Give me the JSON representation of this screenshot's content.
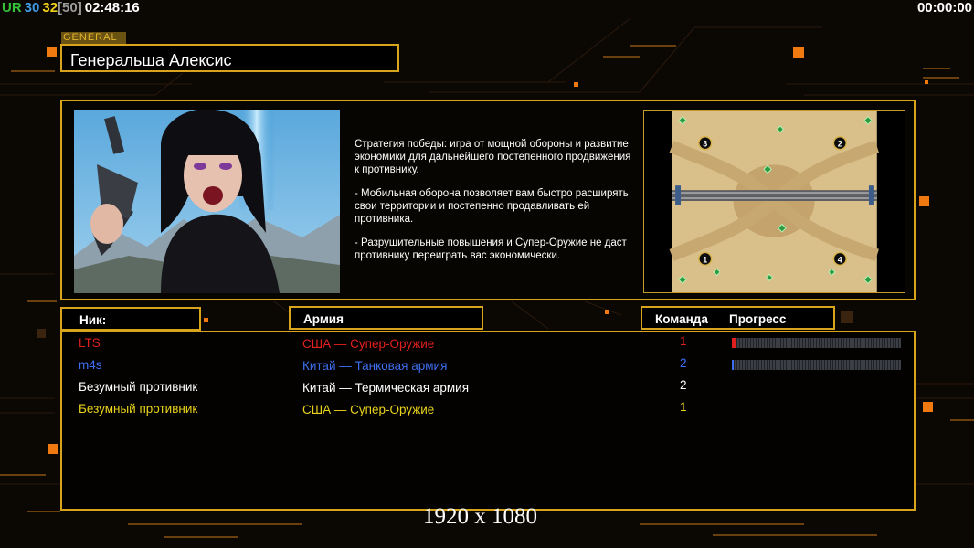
{
  "hud": {
    "tag": "UR",
    "fps": "30",
    "count": "32",
    "count_max": "[50]",
    "clock": "02:48:16",
    "timer": "00:00:00"
  },
  "general": {
    "tag": "GENERAL",
    "name": "Генеральша Алексис"
  },
  "description": {
    "p1": "Стратегия победы: игра от мощной обороны и развитие экономики для дальнейшего постепенного продвижения к противнику.",
    "p2": "- Мобильная оборона позволяет вам быстро расширять свои территории и постепенно продавливать ей противника.",
    "p3": "- Разрушительные повышения и Супер-Оружие не даст противнику переиграть вас экономически."
  },
  "map": {
    "spots": [
      "3",
      "2",
      "1",
      "4"
    ]
  },
  "columns": {
    "nick": "Ник:",
    "army": "Армия",
    "team": "Команда",
    "progress": "Прогресс"
  },
  "players": [
    {
      "nick": "LTS",
      "army": "США — Супер-Оружие",
      "team": "1",
      "color": "#e0201c",
      "progress": 0.02,
      "bar_color": "#e0201c"
    },
    {
      "nick": "m4s",
      "army": "Китай — Танковая армия",
      "team": "2",
      "color": "#3f6ff0",
      "progress": 0.01,
      "bar_color": "#3f6ff0"
    },
    {
      "nick": "Безумный противник",
      "army": "Китай — Термическая армия",
      "team": "2",
      "color": "#ffffff",
      "progress": null,
      "bar_color": ""
    },
    {
      "nick": "Безумный противник",
      "army": "США — Супер-Оружие",
      "team": "1",
      "color": "#e8d21c",
      "progress": null,
      "bar_color": ""
    }
  ],
  "watermark": "1920 x 1080",
  "colors": {
    "accent": "#d8a41c",
    "hud_tag": "#35c23a",
    "hud_fps": "#3f9ae8",
    "hud_count": "#f0d11a",
    "hud_max": "#9a9a9a"
  }
}
